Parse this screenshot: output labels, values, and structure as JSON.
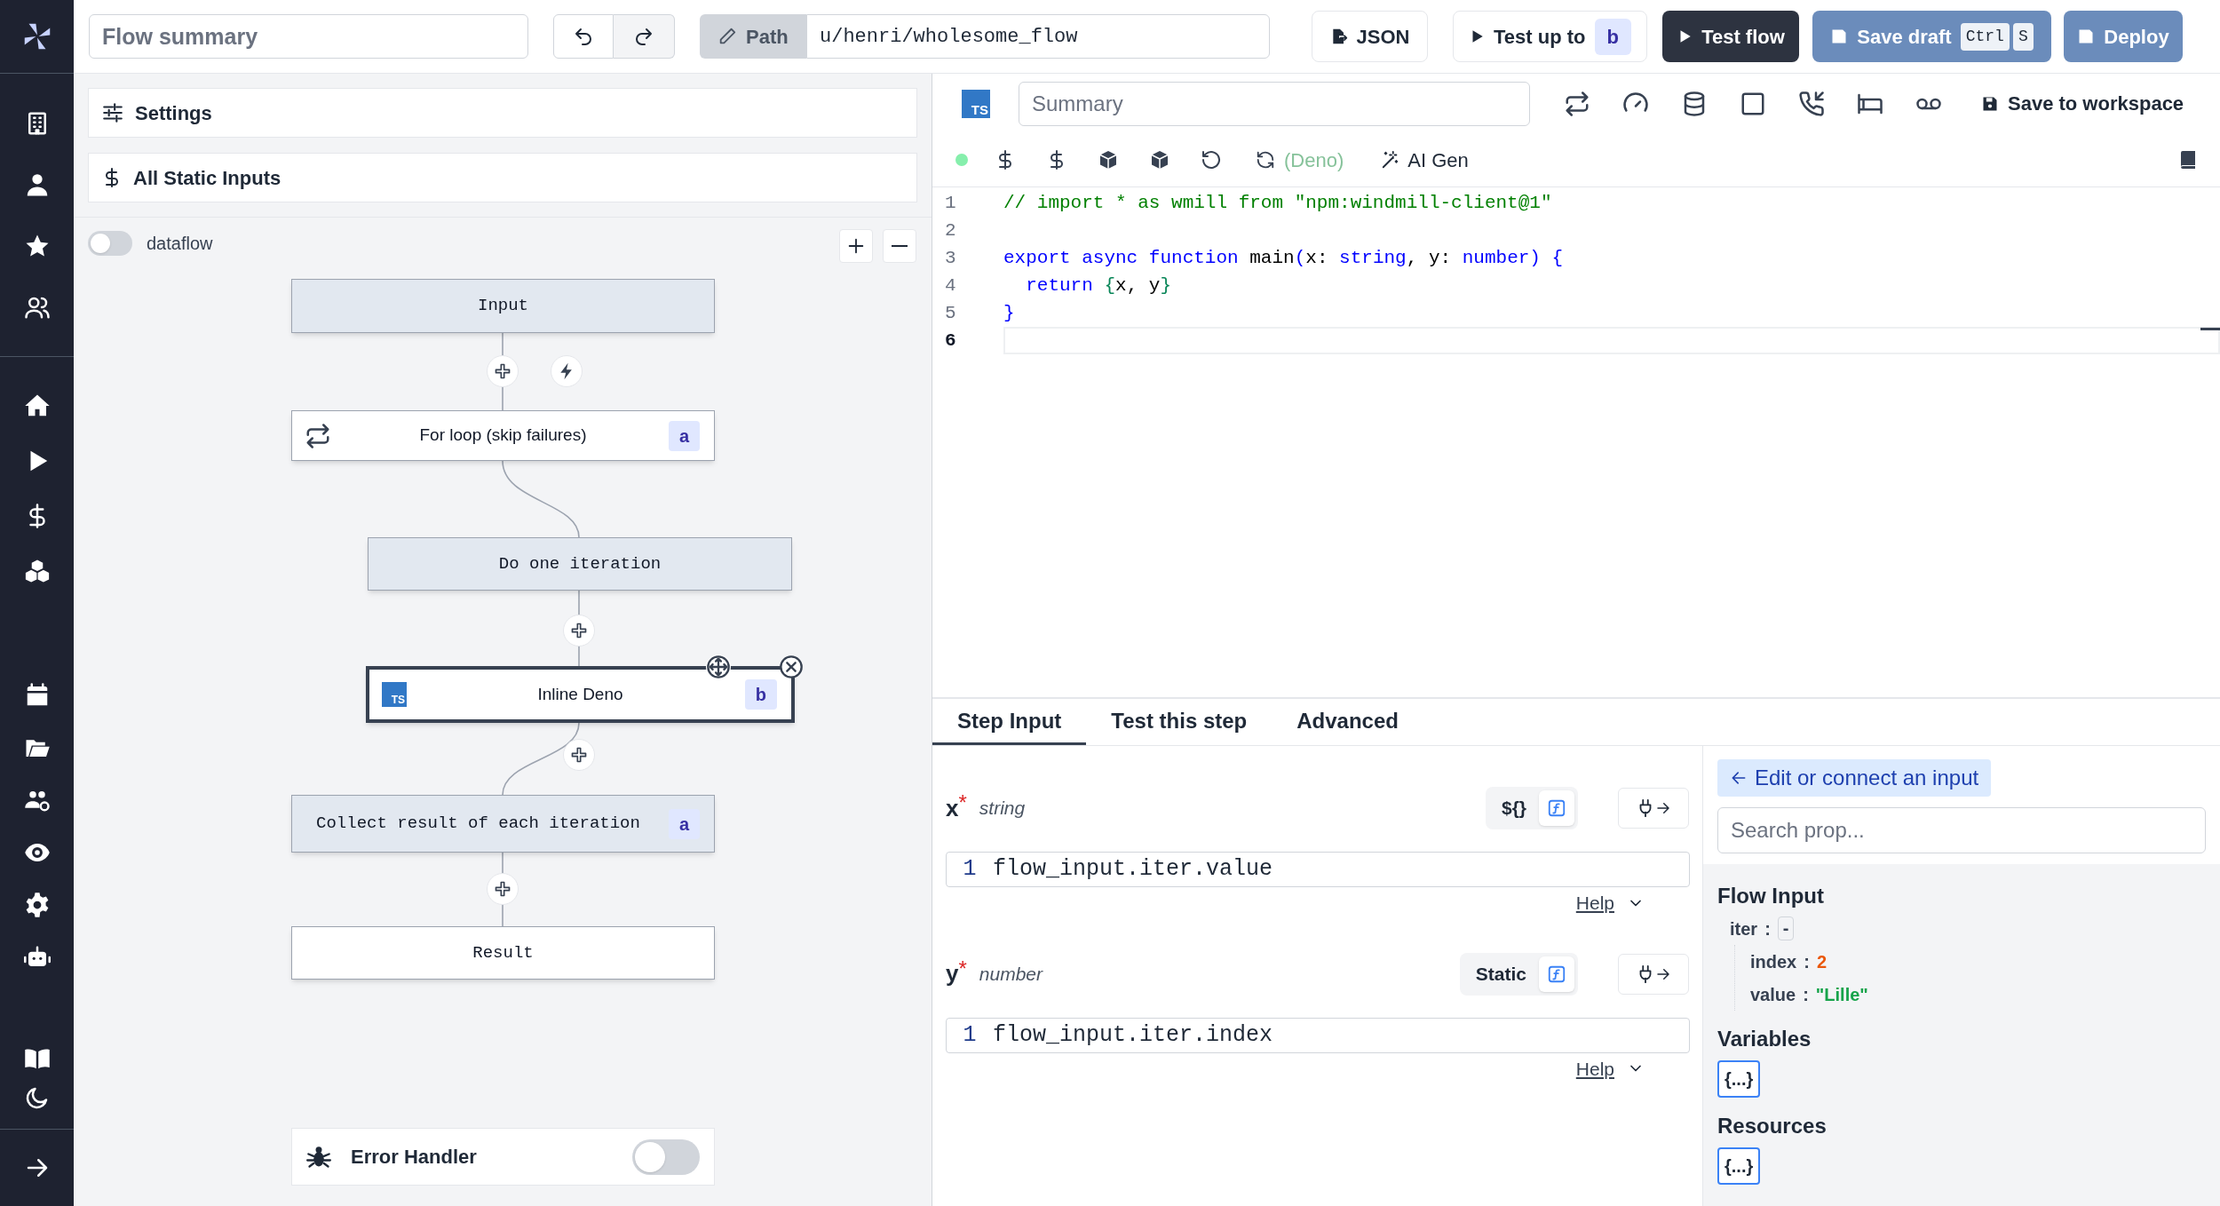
{
  "top_bar": {
    "summary_placeholder": "Flow summary",
    "path_label": "Path",
    "path": "u/henri/wholesome_flow",
    "json_button": "JSON",
    "test_up_to": {
      "label": "Test up to",
      "badge": "b"
    },
    "test_flow": "Test flow",
    "save_draft": {
      "label": "Save draft",
      "keys": [
        "Ctrl",
        "S"
      ]
    },
    "deploy": "Deploy"
  },
  "flow_panel": {
    "settings": "Settings",
    "static_inputs": "All Static Inputs",
    "dataflow": {
      "label": "dataflow",
      "on": false
    },
    "nodes": [
      {
        "kind": "input",
        "label": "Input",
        "selected": false
      },
      {
        "kind": "loop",
        "label": "For loop (skip failures)",
        "badge": "a",
        "selected": false
      },
      {
        "kind": "group",
        "label": "Do one iteration",
        "selected": false
      },
      {
        "kind": "script",
        "label": "Inline Deno",
        "badge": "b",
        "icon_text": "TS",
        "selected": true
      },
      {
        "kind": "group",
        "label": "Collect result of each iteration",
        "badge": "a",
        "selected": false
      },
      {
        "kind": "result",
        "label": "Result",
        "selected": false
      }
    ],
    "error_handler": {
      "label": "Error Handler",
      "on": false
    }
  },
  "editor": {
    "language_badge": "TS",
    "summary_placeholder": "Summary",
    "save": "Save to workspace",
    "runtime": "(Deno)",
    "ai_gen": "AI Gen",
    "lines": [
      {
        "number": "1",
        "current": false,
        "tokens": [
          {
            "kind": "comment",
            "text": "// import * as wmill from \"npm:windmill-client@1\""
          }
        ]
      },
      {
        "number": "2",
        "current": false
      },
      {
        "number": "3",
        "current": false,
        "tokens": [
          {
            "kind": "keyword",
            "text": "export async function"
          },
          {
            "kind": "text",
            "text": " main"
          },
          {
            "kind": "punct",
            "text": "("
          },
          {
            "kind": "text",
            "text": "x: "
          },
          {
            "kind": "keyword",
            "text": "string"
          },
          {
            "kind": "text",
            "text": ", y: "
          },
          {
            "kind": "keyword",
            "text": "number"
          },
          {
            "kind": "punct",
            "text": ")"
          },
          {
            "kind": "punct",
            "text": " {"
          }
        ]
      },
      {
        "number": "4",
        "current": false,
        "tokens": [
          {
            "kind": "keyword",
            "text": "  return"
          },
          {
            "kind": "punct2",
            "text": " {"
          },
          {
            "kind": "text",
            "text": "x, y"
          },
          {
            "kind": "punct2",
            "text": "}"
          }
        ]
      },
      {
        "number": "5",
        "current": false,
        "tokens": [
          {
            "kind": "punct",
            "text": "}"
          }
        ]
      },
      {
        "number": "6",
        "current": true
      }
    ]
  },
  "bottom_panel": {
    "tabs": [
      {
        "label": "Step Input",
        "selected": true
      },
      {
        "label": "Test this step",
        "selected": false
      },
      {
        "label": "Advanced",
        "selected": false
      }
    ],
    "inputs": [
      {
        "name": "x",
        "required_mark": "*",
        "type": "string",
        "mode": "${}",
        "line_number": "1",
        "code": "flow_input.iter.value",
        "help": "Help"
      },
      {
        "name": "y",
        "required_mark": "*",
        "type": "number",
        "mode": "Static",
        "line_number": "1",
        "code": "flow_input.iter.index",
        "help": "Help"
      }
    ],
    "connect_button": "Edit or connect an input",
    "search_placeholder": "Search prop...",
    "flow_input": {
      "title": "Flow Input",
      "entries": [
        {
          "key": "iter",
          "separator": ":",
          "value": "-",
          "kind": "object",
          "children": [
            {
              "key": "index",
              "separator": ":",
              "value": "2",
              "kind": "number"
            },
            {
              "key": "value",
              "separator": ":",
              "value": "\"Lille\"",
              "kind": "string"
            }
          ]
        }
      ]
    },
    "variables": {
      "title": "Variables",
      "button": "{...}"
    },
    "resources": {
      "title": "Resources",
      "button": "{...}"
    }
  }
}
